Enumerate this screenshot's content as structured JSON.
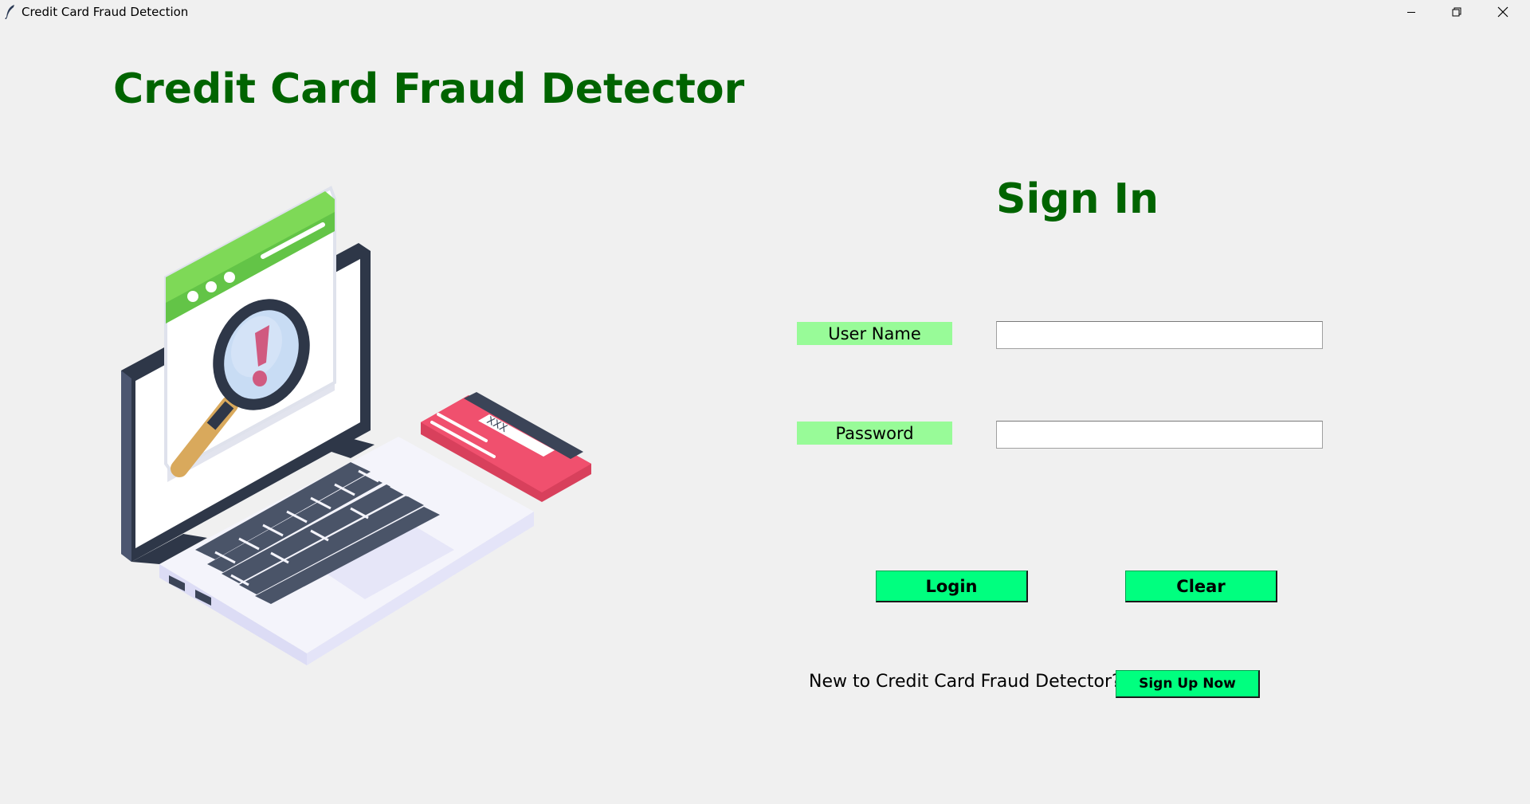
{
  "window": {
    "title": "Credit Card Fraud Detection",
    "controls": [
      "minimize-icon",
      "restore-icon",
      "close-icon"
    ]
  },
  "app_title": "Credit Card Fraud Detector",
  "signin": {
    "heading": "Sign In",
    "username_label": "User Name",
    "username_value": "",
    "password_label": "Password",
    "password_value": "",
    "login_label": "Login",
    "clear_label": "Clear",
    "signup_prompt": "New to Credit Card Fraud Detector?",
    "signup_label": "Sign Up Now"
  },
  "illustration": {
    "semantic": "laptop-fraud-detection-illustration",
    "card_text": "XXX"
  },
  "colors": {
    "title_green": "#006400",
    "label_bg": "#98fb98",
    "button_bg": "#00ff7f",
    "window_bg": "#f0f0f0",
    "card_red": "#f0506e",
    "browser_green": "#7ed957"
  }
}
